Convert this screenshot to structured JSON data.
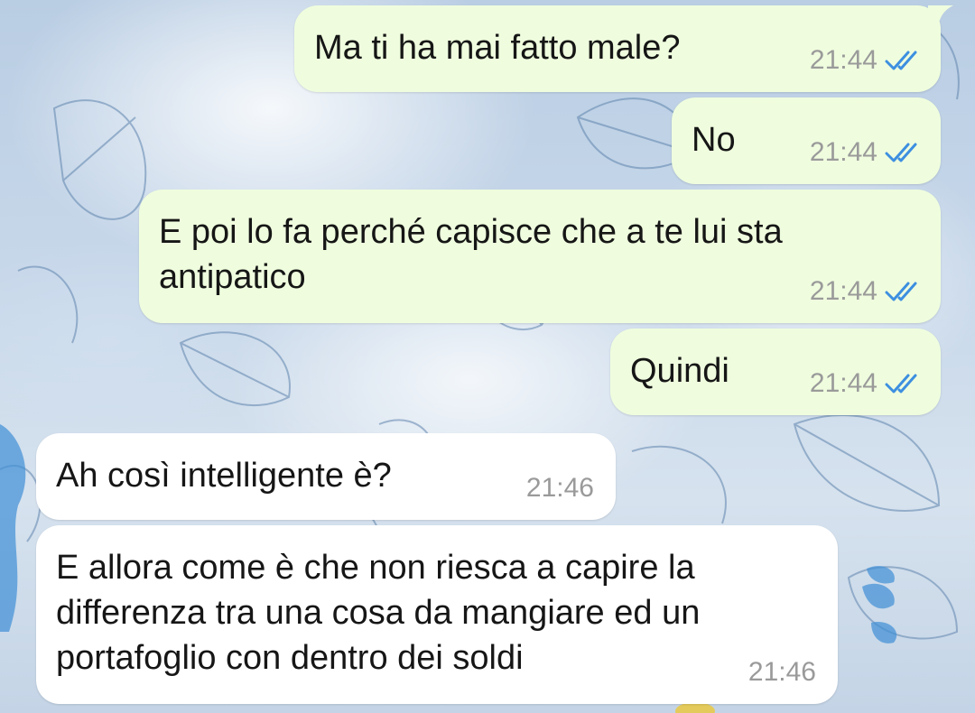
{
  "messages": [
    {
      "direction": "out",
      "text": "Ma ti ha mai fatto male?",
      "time": "21:44",
      "status": "read-icon"
    },
    {
      "direction": "out",
      "text": "No",
      "time": "21:44",
      "status": "read-icon"
    },
    {
      "direction": "out",
      "text": "E poi lo fa perché capisce che a te lui sta\nantipatico",
      "time": "21:44",
      "status": "read-icon"
    },
    {
      "direction": "out",
      "text": "Quindi",
      "time": "21:44",
      "status": "read-icon"
    },
    {
      "direction": "in",
      "text": "Ah così intelligente è?",
      "time": "21:46"
    },
    {
      "direction": "in",
      "text": "E allora come è che non riesca a capire la\ndifferenza tra una cosa da mangiare ed un\nportafoglio con dentro dei soldi",
      "time": "21:46"
    }
  ],
  "colors": {
    "outgoing_bubble": "#effdde",
    "incoming_bubble": "#ffffff",
    "read_ticks": "#3d8fe0",
    "time_text": "#9a9a9a"
  }
}
